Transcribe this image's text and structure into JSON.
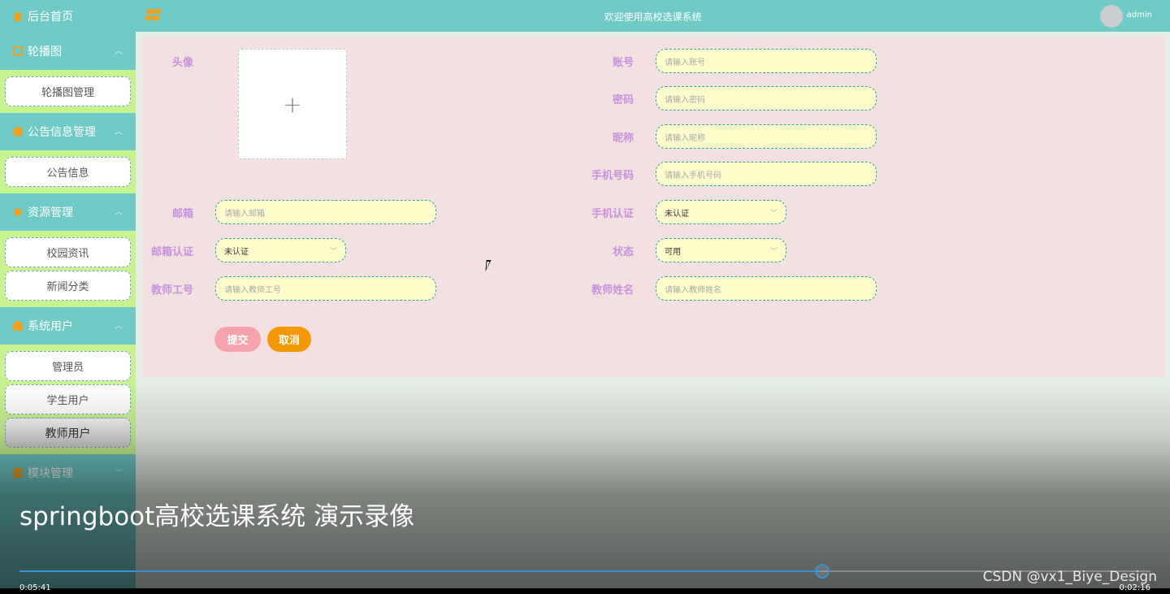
{
  "sidebar": {
    "home": "后台首页",
    "menus": [
      {
        "label": "轮播图",
        "items": [
          "轮播图管理"
        ]
      },
      {
        "label": "公告信息管理",
        "items": [
          "公告信息"
        ]
      },
      {
        "label": "资源管理",
        "items": [
          "校园资讯",
          "新闻分类"
        ]
      },
      {
        "label": "系统用户",
        "items": [
          "管理员",
          "学生用户",
          "教师用户"
        ]
      },
      {
        "label": "模块管理"
      }
    ]
  },
  "topbar": {
    "title": "欢迎使用高校选课系统",
    "username": "admin"
  },
  "form": {
    "avatar_label": "头像",
    "upload_plus": "+",
    "account": {
      "label": "账号",
      "placeholder": "请输入账号"
    },
    "password": {
      "label": "密码",
      "placeholder": "请输入密码"
    },
    "nickname": {
      "label": "昵称",
      "placeholder": "请输入昵称"
    },
    "phone": {
      "label": "手机号码",
      "placeholder": "请输入手机号码"
    },
    "email": {
      "label": "邮箱",
      "placeholder": "请输入邮箱"
    },
    "phone_verify": {
      "label": "手机认证",
      "value": "未认证"
    },
    "email_verify": {
      "label": "邮箱认证",
      "value": "未认证"
    },
    "status": {
      "label": "状态",
      "value": "可用"
    },
    "teacher_id": {
      "label": "教师工号",
      "placeholder": "请输入教师工号"
    },
    "teacher_name": {
      "label": "教师姓名",
      "placeholder": "请输入教师姓名"
    },
    "submit": "提交",
    "cancel": "取消"
  },
  "video": {
    "caption": "springboot高校选课系统 演示录像",
    "time_elapsed": "0:05:41",
    "time_remaining": "0:02:16",
    "progress": 0.71,
    "watermark": "CSDN @vx1_Biye_Design"
  },
  "colors": {
    "sidebar": "#6fcac8",
    "submenu": "#c6f590",
    "panel": "#f3e1e1",
    "input": "#fdfccb",
    "label": "#c891e0",
    "submit": "#f4a3ac",
    "cancel": "#f39800",
    "progress": "#3a8fd6"
  }
}
